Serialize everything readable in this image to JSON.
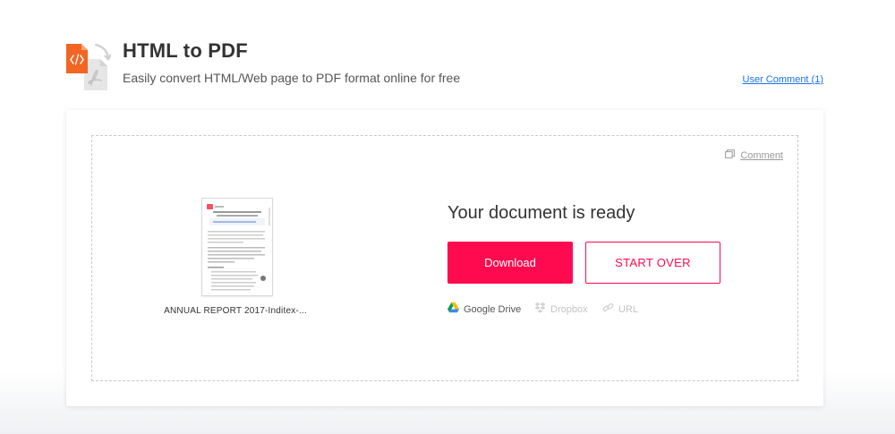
{
  "header": {
    "title": "HTML to PDF",
    "subtitle": "Easily convert HTML/Web page to PDF format online for free",
    "user_comment_link": "User Comment (1)"
  },
  "card": {
    "comment_link": "Comment",
    "file": {
      "name": "ANNUAL REPORT 2017-Inditex-..."
    },
    "status_heading": "Your document is ready",
    "download_button": "Download",
    "start_over_button": "START OVER",
    "share_targets": [
      {
        "label": "Google Drive",
        "icon": "google-drive-icon",
        "enabled": true
      },
      {
        "label": "Dropbox",
        "icon": "dropbox-icon",
        "enabled": false
      },
      {
        "label": "URL",
        "icon": "link-icon",
        "enabled": false
      }
    ]
  },
  "colors": {
    "accent": "#ff0a4f",
    "html_icon": "#f26522",
    "link": "#1a73e8",
    "title_text": "#333333",
    "disabled_text": "#c4c4c4"
  }
}
